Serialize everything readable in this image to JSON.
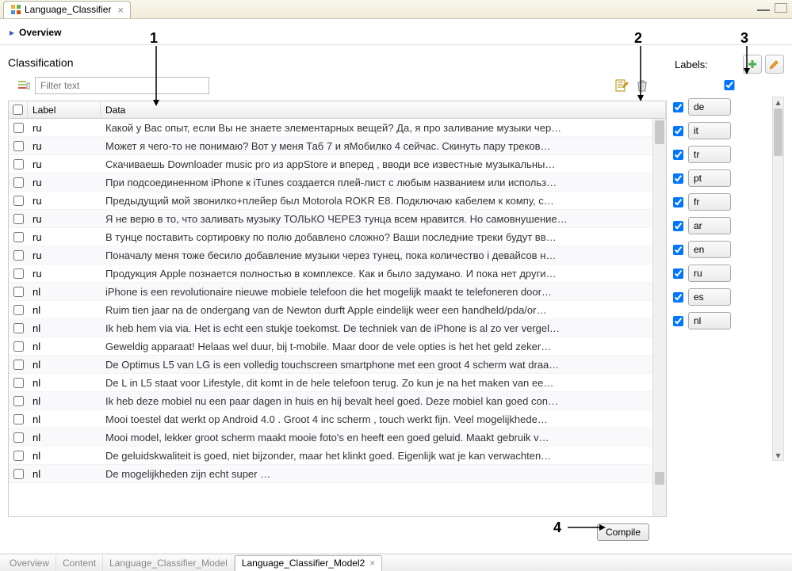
{
  "top_tab": {
    "title": "Language_Classifier"
  },
  "overview": {
    "title": "Overview"
  },
  "classification": {
    "title": "Classification",
    "filter_placeholder": "Filter text",
    "columns": {
      "label": "Label",
      "data": "Data"
    },
    "rows": [
      {
        "label": "ru",
        "data": "Какой у Вас опыт, если Вы не знаете элементарных вещей? Да, я про заливание музыки чер…"
      },
      {
        "label": "ru",
        "data": "Может я чего-то не понимаю? Вот у меня Таб 7 и яМобилко 4 сейчас. Скинуть пару треков…"
      },
      {
        "label": "ru",
        "data": "Скачиваешь Downloader music pro  из appStore  и вперед , вводи все известные музыкальны…"
      },
      {
        "label": "ru",
        "data": "При подсоединенном iPhone к iTunes создается плей-лист с любым названием или использ…"
      },
      {
        "label": "ru",
        "data": "Предыдущий мой звонилко+плейер  был Motorola ROKR E8. Подключаю кабелем  к компу, с…"
      },
      {
        "label": "ru",
        "data": "Я не верю в то, что заливать музыку ТОЛЬКО ЧЕРЕЗ тунца всем нравится. Но самовнушение…"
      },
      {
        "label": "ru",
        "data": "В тунце поставить сортировку по полю добавлено сложно? Ваши последние треки будут вв…"
      },
      {
        "label": "ru",
        "data": "Поначалу меня тоже бесило добавление музыки через тунец, пока количество i девайсов н…"
      },
      {
        "label": "ru",
        "data": "Продукция Apple познается полностью в комплексе. Как и было задумано. И пока нет други…"
      },
      {
        "label": "nl",
        "data": "iPhone is een revolutionaire nieuwe mobiele telefoon die het mogelijk maakt te telefoneren door…"
      },
      {
        "label": "nl",
        "data": "Ruim tien jaar na de ondergang van de Newton durft Apple eindelijk weer een handheld/pda/or…"
      },
      {
        "label": "nl",
        "data": "Ik heb hem via via. Het is echt een stukje toekomst. De techniek van de iPhone is al zo ver vergel…"
      },
      {
        "label": "nl",
        "data": "Geweldig apparaat! Helaas wel duur, bij t-mobile. Maar door de vele opties is het het geld zeker…"
      },
      {
        "label": "nl",
        "data": "De Optimus L5 van LG is een volledig touchscreen smartphone met een groot 4 scherm wat draa…"
      },
      {
        "label": "nl",
        "data": "De L in L5 staat voor Lifestyle, dit komt in de hele telefoon terug. Zo kun je na het maken van ee…"
      },
      {
        "label": "nl",
        "data": "Ik heb deze mobiel nu een paar dagen in huis en hij bevalt heel goed. Deze mobiel kan goed con…"
      },
      {
        "label": "nl",
        "data": "Mooi toestel dat werkt op Android 4.0 . Groot 4 inc scherm , touch werkt fijn. Veel mogelijkhede…"
      },
      {
        "label": "nl",
        "data": "Mooi model, lekker groot scherm maakt mooie foto's en heeft een goed geluid. Maakt gebruik v…"
      },
      {
        "label": "nl",
        "data": "De geluidskwaliteit is goed, niet bijzonder, maar het klinkt goed. Eigenlijk wat je kan verwachten…"
      },
      {
        "label": "nl",
        "data": "De mogelijkheden zijn echt super …"
      }
    ]
  },
  "compile_label": "Compile",
  "labels_panel": {
    "title": "Labels:",
    "items": [
      {
        "code": "de",
        "checked": true
      },
      {
        "code": "it",
        "checked": true
      },
      {
        "code": "tr",
        "checked": true
      },
      {
        "code": "pt",
        "checked": true
      },
      {
        "code": "fr",
        "checked": true
      },
      {
        "code": "ar",
        "checked": true
      },
      {
        "code": "en",
        "checked": true
      },
      {
        "code": "ru",
        "checked": true
      },
      {
        "code": "es",
        "checked": true
      },
      {
        "code": "nl",
        "checked": true
      }
    ]
  },
  "bottom_tabs": {
    "items": [
      {
        "label": "Overview",
        "active": false
      },
      {
        "label": "Content",
        "active": false
      },
      {
        "label": "Language_Classifier_Model",
        "active": false
      },
      {
        "label": "Language_Classifier_Model2",
        "active": true
      }
    ]
  },
  "annotations": {
    "n1": "1",
    "n2": "2",
    "n3": "3",
    "n4": "4"
  }
}
